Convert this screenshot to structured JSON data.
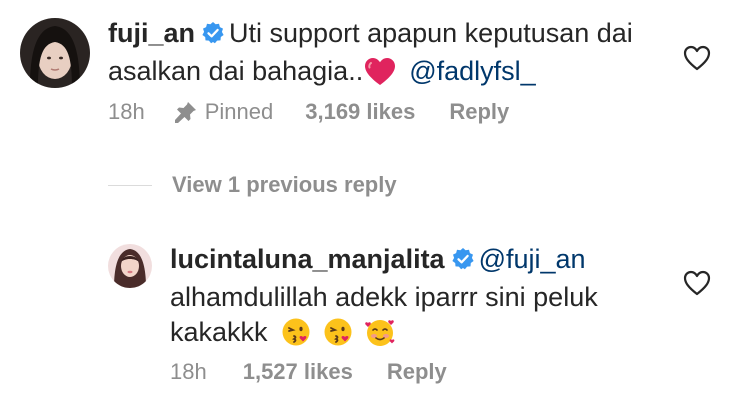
{
  "comments": [
    {
      "username": "fuji_an",
      "verified": true,
      "text": "Uti support apapun keputusan dai asalkan dai bahagia..",
      "emoji": "red-heart",
      "mention": "@fadlyfsl_",
      "time": "18h",
      "pinned_label": "Pinned",
      "likes": "3,169 likes",
      "reply_label": "Reply",
      "liked": false
    },
    {
      "username": "lucintaluna_manjalita",
      "verified": true,
      "mention": "@fuji_an",
      "text": "alhamdulillah adekk iparrr sini peluk kakakkk",
      "emojis": [
        "kissing-heart",
        "kissing-heart",
        "smiling-hearts"
      ],
      "time": "18h",
      "likes": "1,527 likes",
      "reply_label": "Reply",
      "liked": false
    }
  ],
  "view_replies_label": "View 1 previous reply",
  "colors": {
    "text": "#262626",
    "meta": "#8e8e8e",
    "mention": "#00376b",
    "verified": "#3897f0",
    "heart_emoji": "#e0245e",
    "separator": "#dbdbdb"
  }
}
